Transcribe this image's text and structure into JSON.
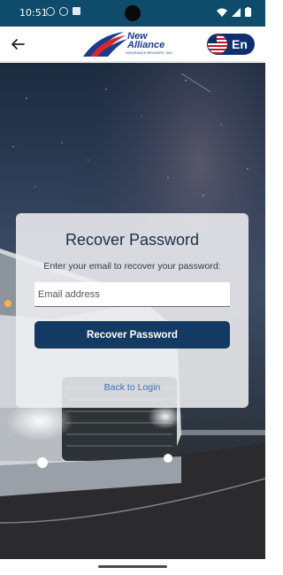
{
  "status_bar": {
    "time": "10:51"
  },
  "header": {
    "logo_name_line1": "New",
    "logo_name_line2": "Alliance",
    "logo_tagline": "INSURANCE BROKERS, INC.",
    "language_code": "En"
  },
  "recover": {
    "title": "Recover Password",
    "instruction": "Enter your email to recover your password:",
    "email_placeholder": "Email address",
    "submit_label": "Recover Password",
    "back_link": "Back to Login"
  },
  "colors": {
    "status_bar": "#0f4c6b",
    "primary_button": "#123a63",
    "language_pill": "#0e2f6e",
    "link": "#3b6fb6"
  },
  "icons": [
    "back-arrow-icon",
    "us-flag-icon",
    "wifi-icon",
    "signal-icon",
    "battery-icon"
  ]
}
